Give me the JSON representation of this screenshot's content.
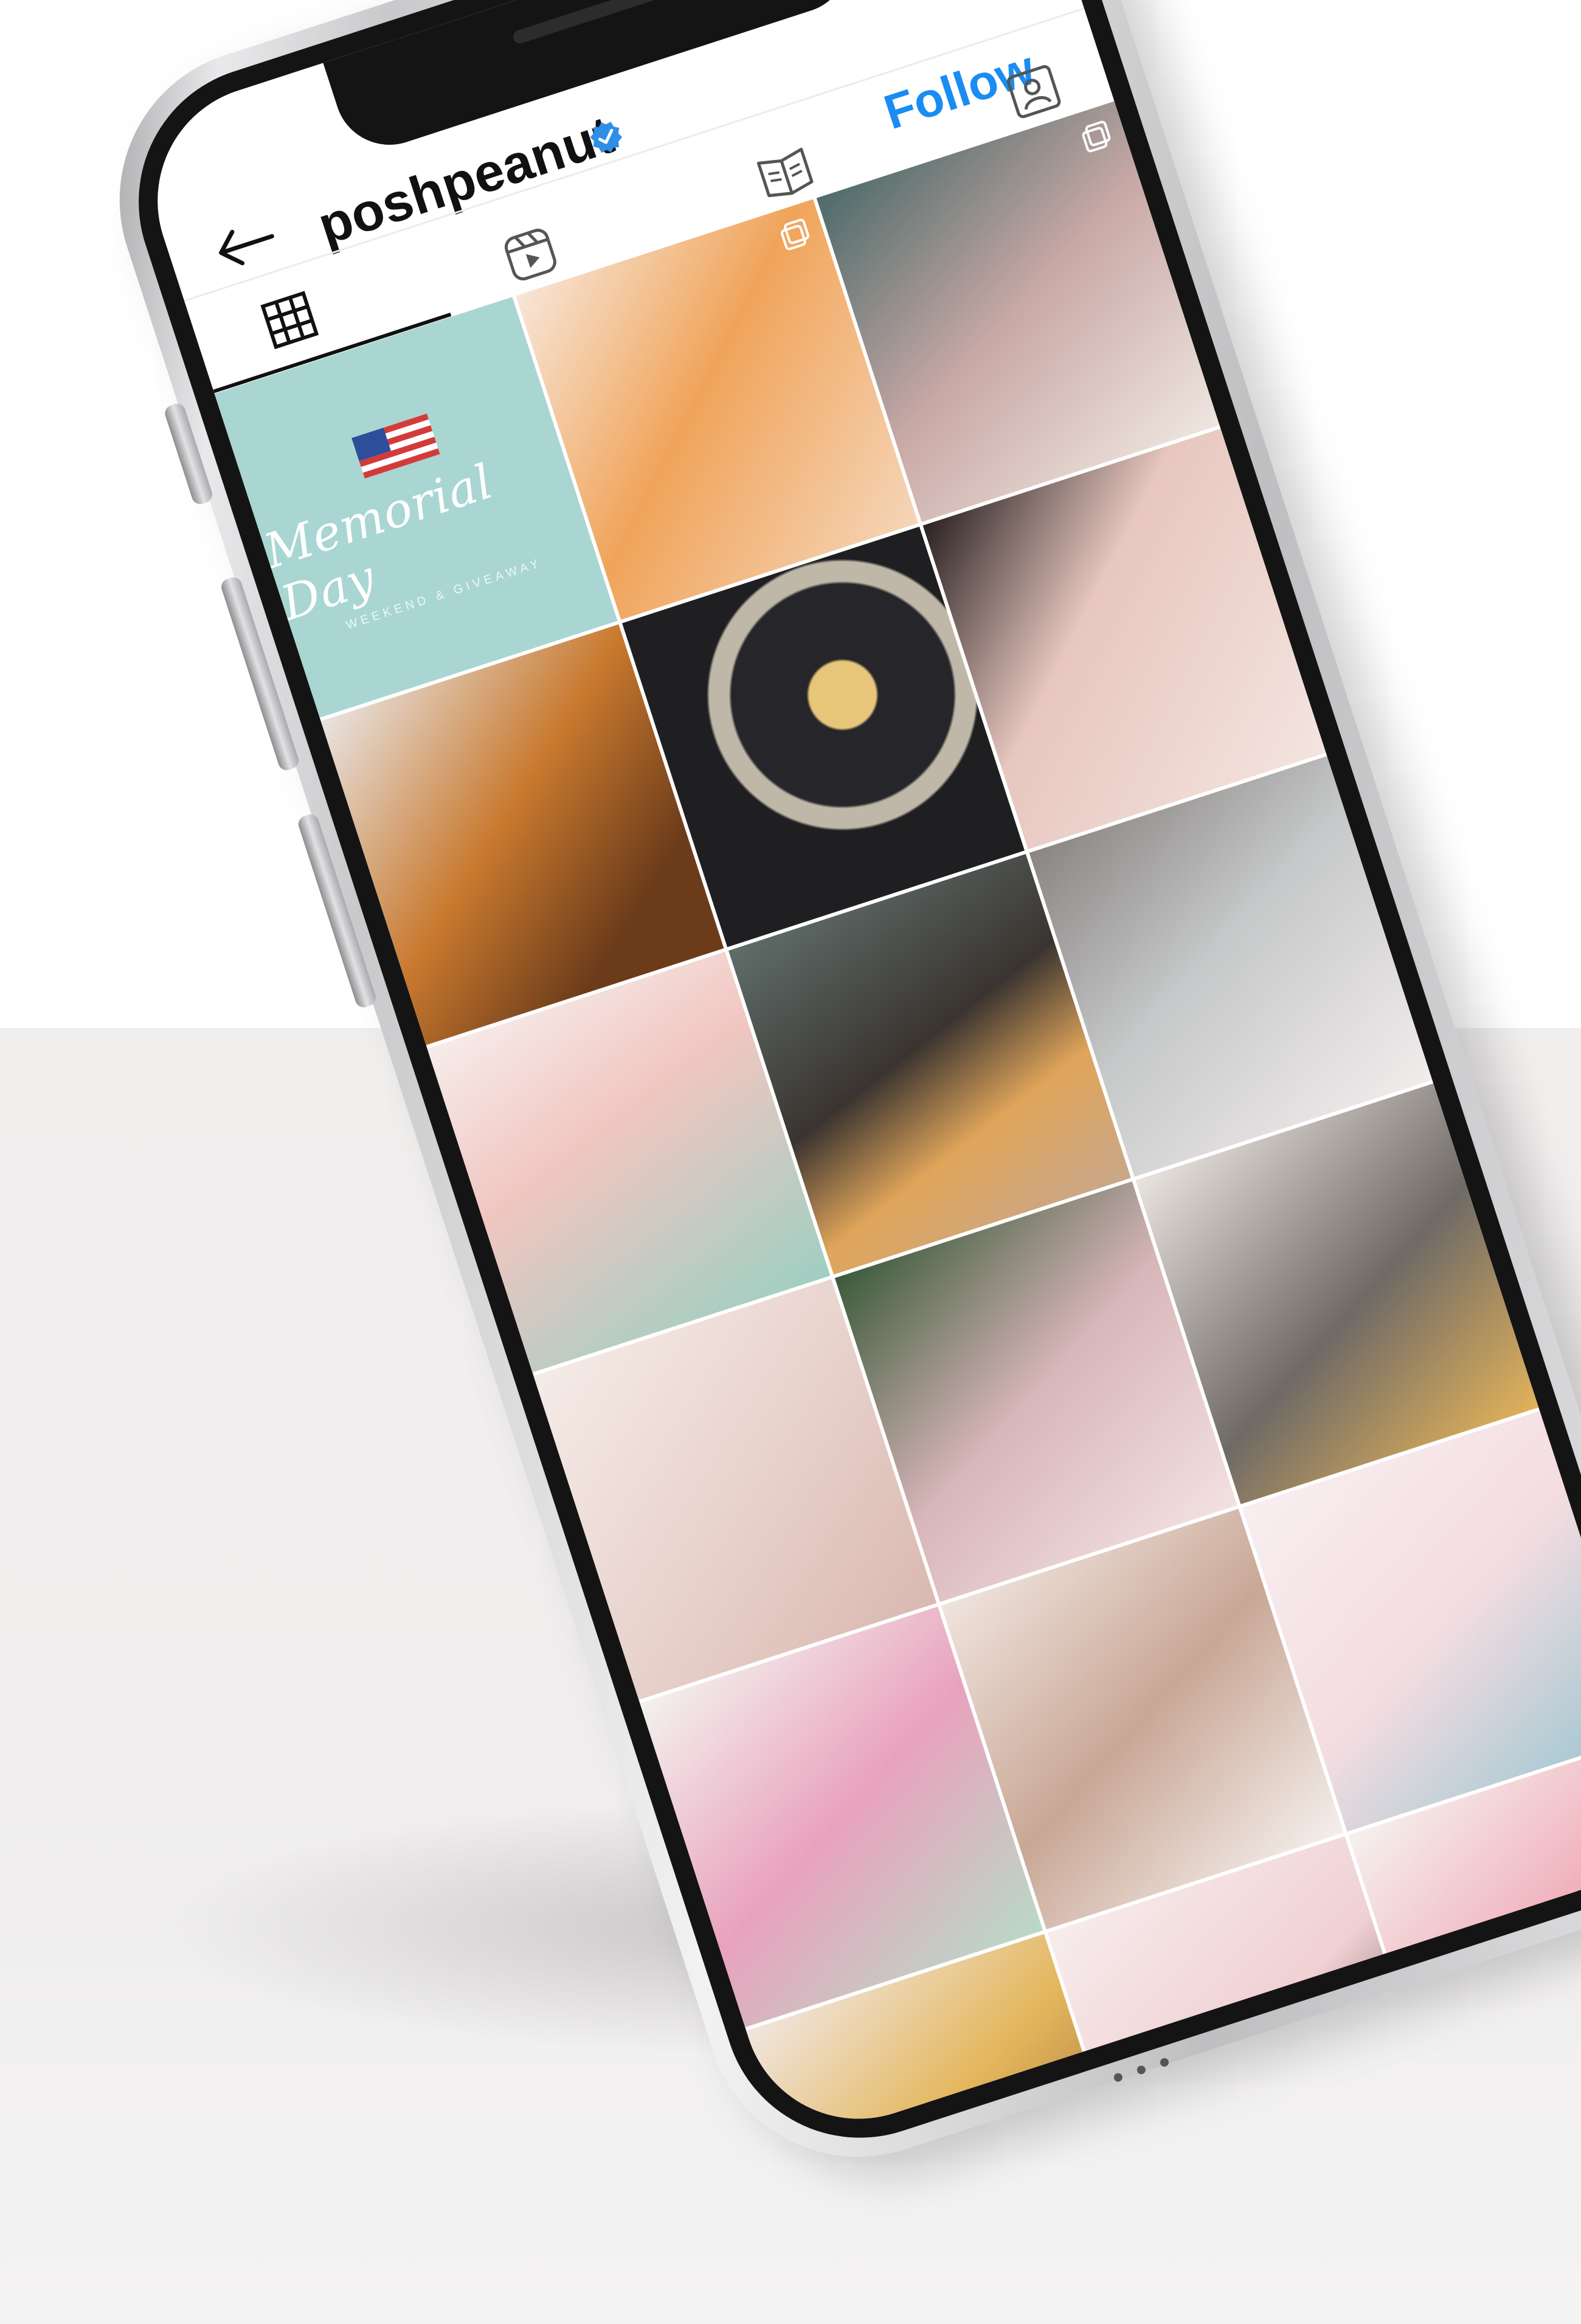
{
  "profile": {
    "username": "poshpeanut",
    "verified": true,
    "follow_label": "Follow"
  },
  "colors": {
    "follow": "#1a8cf2",
    "verified": "#2f8fe6",
    "text": "#111111"
  },
  "icons": {
    "back": "arrow-left-icon",
    "verified": "verified-badge-icon",
    "tabs": [
      "grid-icon",
      "reels-icon",
      "guides-icon",
      "tagged-icon"
    ]
  },
  "tabs": {
    "active": "grid"
  },
  "posts": [
    {
      "title": "Memorial Day",
      "subtitle": "WEEKEND & GIVEAWAY",
      "bg": "#a9d6d2"
    },
    {
      "bg": "#f0a45a",
      "multi": true
    },
    {
      "bg": "#c9a9a6",
      "multi": true
    },
    {
      "bg": "#c8792e"
    },
    {
      "bg": "#26262a"
    },
    {
      "bg": "#e7c7bf"
    },
    {
      "bg": "#f1c6c1"
    },
    {
      "bg": "#3a3430"
    },
    {
      "bg": "#c6c8c9"
    },
    {
      "bg": "#e9d3cd"
    },
    {
      "bg": "#d8b6b9"
    },
    {
      "bg": "#6f6a66"
    },
    {
      "bg": "#e9a2bd"
    },
    {
      "bg": "#efe4de"
    },
    {
      "bg": "#f4dde1"
    },
    {
      "bg": "#e4b65b"
    },
    {
      "bg": "#f0d0d3"
    },
    {
      "bg": "#f5f1ee"
    }
  ]
}
